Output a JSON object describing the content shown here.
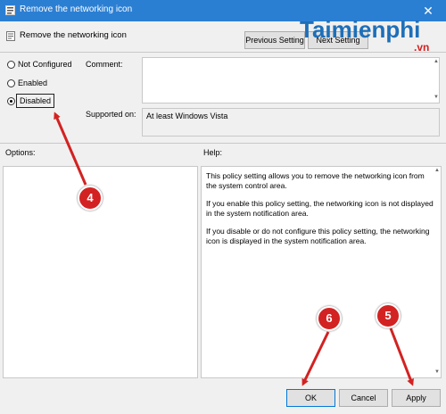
{
  "window": {
    "title": "Remove the networking icon",
    "close_glyph": "✕"
  },
  "policy": {
    "title": "Remove the networking icon"
  },
  "nav": {
    "previous_label": "Previous Setting",
    "next_label": "Next Setting"
  },
  "radio": {
    "not_configured": "Not Configured",
    "enabled": "Enabled",
    "disabled": "Disabled",
    "selected": "Disabled"
  },
  "comment": {
    "label": "Comment:",
    "value": ""
  },
  "supported": {
    "label": "Supported on:",
    "value": "At least Windows Vista"
  },
  "options": {
    "label": "Options:"
  },
  "help": {
    "label": "Help:",
    "paragraphs": [
      "This policy setting allows you to remove the networking icon from the system control area.",
      "If you enable this policy setting, the networking icon is not displayed in the system notification area.",
      "If you disable or do not configure this policy setting, the networking icon is displayed in the system notification area."
    ]
  },
  "buttons": {
    "ok": "OK",
    "cancel": "Cancel",
    "apply": "Apply"
  },
  "annotations": {
    "badge_4": "4",
    "badge_5": "5",
    "badge_6": "6",
    "arrow_color": "#d32222"
  },
  "watermark": {
    "brand": "Taimienphi",
    "tld": ".vn",
    "color": "#1d6fb8",
    "tld_color": "#d32222"
  },
  "colors": {
    "titlebar": "#2b7fd3",
    "window_bg": "#f0f0f0",
    "accent": "#0078d7"
  }
}
